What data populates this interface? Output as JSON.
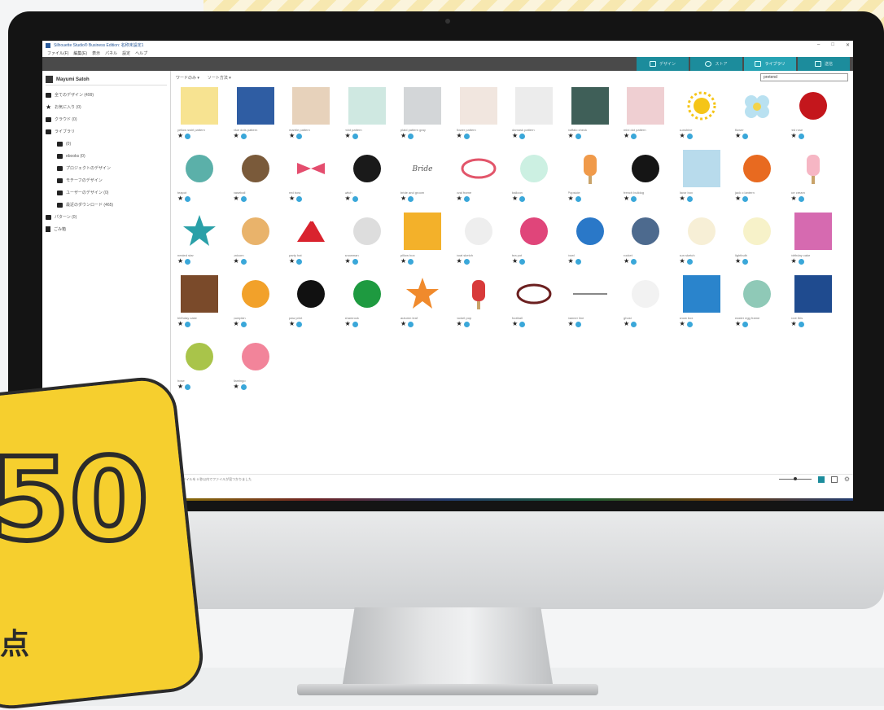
{
  "window": {
    "title": "Silhouette Studio® Business Edition: 名称未設定1",
    "controls": [
      "–",
      "□",
      "✕"
    ]
  },
  "menu": [
    "ファイル(F)",
    "編集(E)",
    "表示",
    "パネル",
    "設定",
    "ヘルプ"
  ],
  "tabs": [
    {
      "label": "デザイン",
      "active": false
    },
    {
      "label": "ストア",
      "active": false
    },
    {
      "label": "ライブラリ",
      "active": true
    },
    {
      "label": "送信",
      "active": false
    }
  ],
  "sidebar": {
    "user": "Mayumi Satoh",
    "items": [
      {
        "label": "全てのデザイン (499)",
        "icon": "folder",
        "child": false
      },
      {
        "label": "お気に入り (0)",
        "icon": "star",
        "child": false
      },
      {
        "label": "クラウド (0)",
        "icon": "folder",
        "child": false
      },
      {
        "label": "ライブラリ",
        "icon": "folder",
        "child": false
      },
      {
        "label": "(0)",
        "icon": "folder",
        "child": true
      },
      {
        "label": "ebooks (0)",
        "icon": "folder",
        "child": true
      },
      {
        "label": "プロジェクトのデザイン",
        "icon": "folder",
        "child": true
      },
      {
        "label": "モチーフのデザイン",
        "icon": "folder",
        "child": true
      },
      {
        "label": "ユーザーのデザイン (0)",
        "icon": "folder",
        "child": true
      },
      {
        "label": "最近のダウンロード (465)",
        "icon": "folder",
        "child": true
      },
      {
        "label": "パターン (0)",
        "icon": "folder",
        "child": false
      },
      {
        "label": "ごみ箱",
        "icon": "trash",
        "child": false
      }
    ]
  },
  "toolbar": {
    "view": "ワードのみ ▾",
    "sort": "ソート方法 ▾",
    "search_value": "pretend"
  },
  "designs": [
    {
      "label": "yellow swirl pattern",
      "color": "#f7e391",
      "shape": "square"
    },
    {
      "label": "blue dots pattern",
      "color": "#2f5da3",
      "shape": "square"
    },
    {
      "label": "marble pattern",
      "color": "#e7d2bb",
      "shape": "square"
    },
    {
      "label": "mint pattern",
      "color": "#cfe8e1",
      "shape": "square"
    },
    {
      "label": "plaid pattern gray",
      "color": "#d3d6d8",
      "shape": "square"
    },
    {
      "label": "flower pattern",
      "color": "#f1e6df",
      "shape": "square"
    },
    {
      "label": "damask pattern",
      "color": "#ececec",
      "shape": "square"
    },
    {
      "label": "buffalo check",
      "color": "#3f5f58",
      "shape": "square"
    },
    {
      "label": "mini dot pattern",
      "color": "#efcfd2",
      "shape": "square"
    },
    {
      "label": "sunshine",
      "color": "#f5c518",
      "shape": "sun"
    },
    {
      "label": "flower",
      "color": "#b9e1f1",
      "shape": "flower"
    },
    {
      "label": "red rose",
      "color": "#c4161c",
      "shape": "circle"
    },
    {
      "label": "teapot",
      "color": "#5bb0a9",
      "shape": "circle"
    },
    {
      "label": "baseball",
      "color": "#7a5a3a",
      "shape": "circle"
    },
    {
      "label": "red bow",
      "color": "#e44d6e",
      "shape": "bow"
    },
    {
      "label": "witch",
      "color": "#1a1a1a",
      "shape": "circle"
    },
    {
      "label": "bride and groom",
      "color": "#555555",
      "shape": "text"
    },
    {
      "label": "oval frame",
      "color": "#e2556a",
      "shape": "oval"
    },
    {
      "label": "balloon",
      "color": "#ccf0e2",
      "shape": "circle"
    },
    {
      "label": "Popsicle",
      "color": "#f09a4a",
      "shape": "popsicle"
    },
    {
      "label": "french bulldog",
      "color": "#151515",
      "shape": "circle"
    },
    {
      "label": "favor box",
      "color": "#b8dbec",
      "shape": "square"
    },
    {
      "label": "jack o lantern",
      "color": "#e86a20",
      "shape": "circle"
    },
    {
      "label": "ice cream",
      "color": "#f6b6c4",
      "shape": "popsicle"
    },
    {
      "label": "nested star",
      "color": "#2aa0a8",
      "shape": "star"
    },
    {
      "label": "unicorn",
      "color": "#e9b36b",
      "shape": "circle"
    },
    {
      "label": "party hat",
      "color": "#d9232e",
      "shape": "hat"
    },
    {
      "label": "snowman",
      "color": "#dddddd",
      "shape": "circle"
    },
    {
      "label": "pillow box",
      "color": "#f3b12a",
      "shape": "square"
    },
    {
      "label": "boat sketch",
      "color": "#eeeeee",
      "shape": "circle"
    },
    {
      "label": "tea pot",
      "color": "#e0457a",
      "shape": "circle"
    },
    {
      "label": "bowl",
      "color": "#2a78c8",
      "shape": "circle"
    },
    {
      "label": "rocket",
      "color": "#4d6a8e",
      "shape": "circle"
    },
    {
      "label": "sun sketch",
      "color": "#f7efd6",
      "shape": "circle"
    },
    {
      "label": "lightbulb",
      "color": "#f7f2c9",
      "shape": "circle"
    },
    {
      "label": "birthday cake",
      "color": "#d66ab0",
      "shape": "square"
    },
    {
      "label": "birthday cake",
      "color": "#7a4a2a",
      "shape": "square"
    },
    {
      "label": "pumpkin",
      "color": "#f2a12a",
      "shape": "circle"
    },
    {
      "label": "paw print",
      "color": "#111111",
      "shape": "circle"
    },
    {
      "label": "shamrock",
      "color": "#1e9a40",
      "shape": "circle"
    },
    {
      "label": "autumn leaf",
      "color": "#f08a2c",
      "shape": "star"
    },
    {
      "label": "rocket pop",
      "color": "#d83a3a",
      "shape": "popsicle"
    },
    {
      "label": "football",
      "color": "#6b1f1f",
      "shape": "oval"
    },
    {
      "label": "banner line",
      "color": "#888888",
      "shape": "line"
    },
    {
      "label": "ghost",
      "color": "#f2f2f2",
      "shape": "circle"
    },
    {
      "label": "snow box",
      "color": "#2a84cc",
      "shape": "square"
    },
    {
      "label": "easter egg frame",
      "color": "#8fc9b7",
      "shape": "circle"
    },
    {
      "label": "love this",
      "color": "#1f4b8f",
      "shape": "square"
    },
    {
      "label": "hose",
      "color": "#a9c44a",
      "shape": "circle"
    },
    {
      "label": "flamingo",
      "color": "#f2849a",
      "shape": "circle"
    }
  ],
  "status": {
    "text": "250ファイルを 0 秒以内でファイルが見つかりました"
  },
  "badge": {
    "number": "50",
    "unit": "点"
  }
}
